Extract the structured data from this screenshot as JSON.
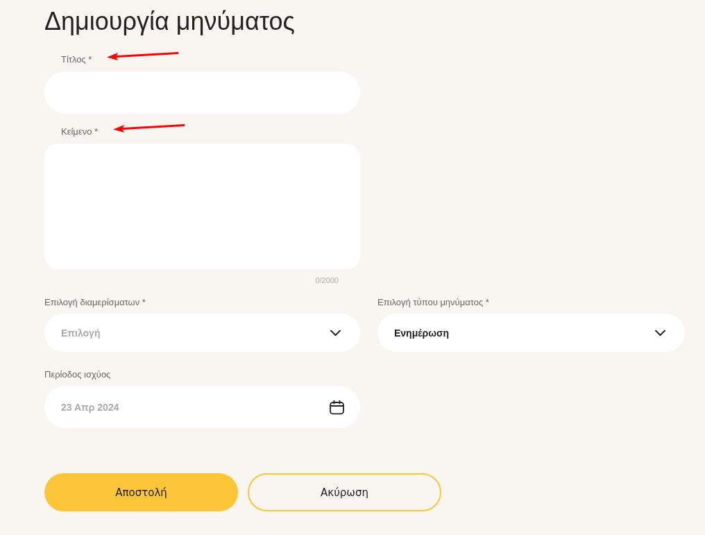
{
  "page": {
    "title": "Δημιουργία μηνύματος"
  },
  "fields": [
    {
      "kind": "text",
      "label": "Τίτλος *",
      "marked": true
    },
    {
      "kind": "textarea",
      "label": "Κείμενο *",
      "marked": true,
      "counter": "0/2000"
    },
    {
      "kind": "select",
      "label": "Επιλογή διαμερίσματων *",
      "marked": false,
      "placeholder": "Επιλογή"
    },
    {
      "kind": "select",
      "label": "Επιλογή τύπου μηνύματος *",
      "marked": false,
      "value": "Ενημέρωση"
    },
    {
      "kind": "date",
      "label": "Περίοδος ισχύος",
      "marked": false,
      "placeholder": "23 Απρ 2024"
    }
  ],
  "buttons": [
    {
      "kind": "primary",
      "label": "Αποστολή"
    },
    {
      "kind": "secondary",
      "label": "Ακύρωση"
    }
  ]
}
